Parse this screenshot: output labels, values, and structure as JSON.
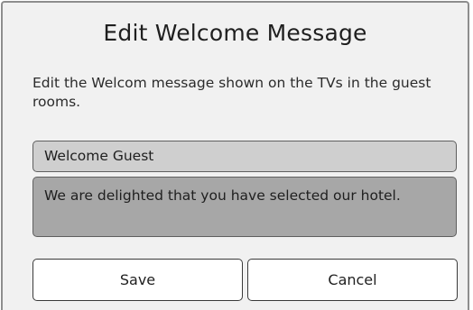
{
  "dialog": {
    "title": "Edit Welcome Message",
    "description": "Edit the Welcom message shown on the TVs in the guest rooms.",
    "title_field": {
      "value": "Welcome Guest"
    },
    "body_field": {
      "value": "We are delighted that you have selected our hotel."
    },
    "buttons": {
      "save_label": "Save",
      "cancel_label": "Cancel"
    }
  },
  "colors": {
    "dialog_background": "#f1f1f1",
    "dialog_border": "#8e8e8e",
    "title_field_background": "#cfcfcf",
    "body_field_background": "#a7a7a7",
    "button_background": "#ffffff"
  }
}
